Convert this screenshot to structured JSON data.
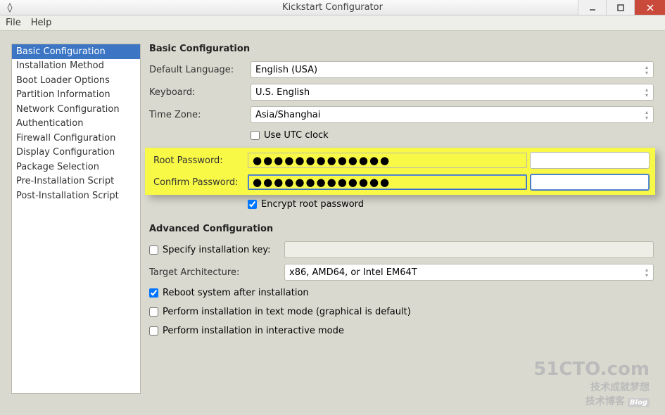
{
  "window": {
    "title": "Kickstart Configurator"
  },
  "menubar": {
    "file": "File",
    "help": "Help"
  },
  "sidebar": {
    "items": [
      "Basic Configuration",
      "Installation Method",
      "Boot Loader Options",
      "Partition Information",
      "Network Configuration",
      "Authentication",
      "Firewall Configuration",
      "Display Configuration",
      "Package Selection",
      "Pre-Installation Script",
      "Post-Installation Script"
    ],
    "selected_index": 0
  },
  "basic": {
    "title": "Basic Configuration",
    "labels": {
      "default_language": "Default Language:",
      "keyboard": "Keyboard:",
      "time_zone": "Time Zone:",
      "use_utc": "Use UTC clock",
      "root_password": "Root Password:",
      "confirm_password": "Confirm Password:",
      "encrypt_root": "Encrypt root password"
    },
    "values": {
      "default_language": "English (USA)",
      "keyboard": "U.S. English",
      "time_zone": "Asia/Shanghai",
      "use_utc": false,
      "root_password_mask": "●●●●●●●●●●●●●",
      "confirm_password_mask": "●●●●●●●●●●●●●",
      "encrypt_root": true
    }
  },
  "advanced": {
    "title": "Advanced Configuration",
    "labels": {
      "specify_key": "Specify installation key:",
      "target_arch": "Target Architecture:",
      "reboot": "Reboot system after installation",
      "text_mode": "Perform installation in text mode (graphical is default)",
      "interactive_mode": "Perform installation in interactive mode"
    },
    "values": {
      "specify_key_checked": false,
      "specify_key_value": "",
      "target_arch": "x86, AMD64, or Intel EM64T",
      "reboot": true,
      "text_mode": false,
      "interactive_mode": false
    }
  },
  "watermark": {
    "big": "51CTO.com",
    "small": "技术成就梦想",
    "sub": "技术博客",
    "blog": "Blog"
  }
}
